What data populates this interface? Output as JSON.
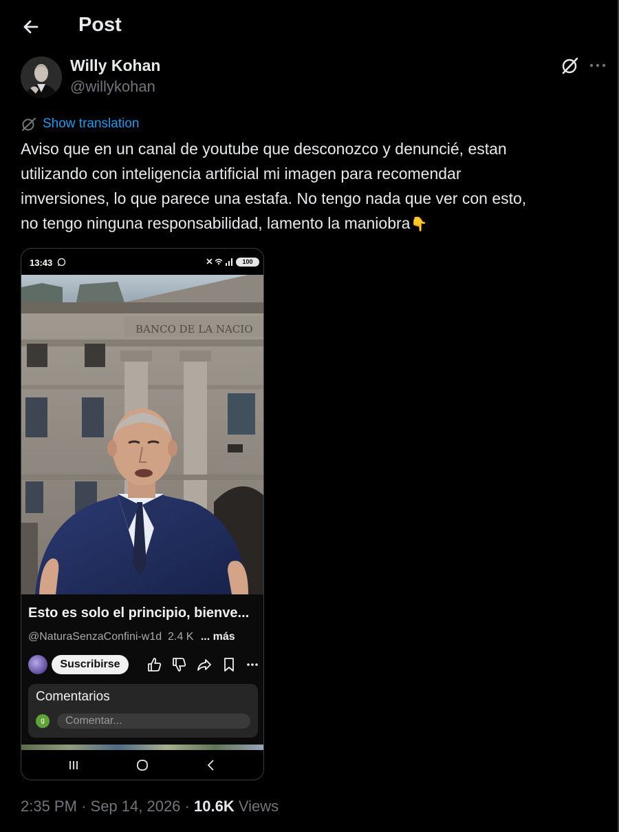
{
  "header": {
    "title": "Post",
    "back_icon": "arrow-left-icon"
  },
  "author": {
    "name": "Willy Kohan",
    "handle": "@willykohan"
  },
  "actions": {
    "grok_icon": "grok-icon",
    "more_icon": "more-horizontal-icon"
  },
  "translation": {
    "label": "Show translation",
    "icon": "translate-icon",
    "color": "#1d9bf0"
  },
  "post": {
    "text": "Aviso que en un canal de youtube que desconozco y denuncié, estan\nutilizando con inteligencia artificial mi imagen para recomendar\nimversiones, lo que parece una estafa. No tengo nada que ver con esto,\nno tengo ninguna responsabilidad, lamento la maniobra",
    "emoji": "👇"
  },
  "media": {
    "status_time": "13:43",
    "battery": "100",
    "building_sign": "BANCO DE LA NACIO",
    "video_title": "Esto es solo el principio, bienve...",
    "channel": "@NaturaSenzaConfini-w1d",
    "subscribers": "2.4 K",
    "more_label": "... más",
    "subscribe_label": "Suscribirse",
    "comments_title": "Comentarios",
    "comment_avatar_letter": "g",
    "comment_placeholder": "Comentar..."
  },
  "meta": {
    "time": "2:35 PM",
    "date": "Sep 14, 2026",
    "separator": "·",
    "views_count": "10.6K",
    "views_label": "Views"
  }
}
